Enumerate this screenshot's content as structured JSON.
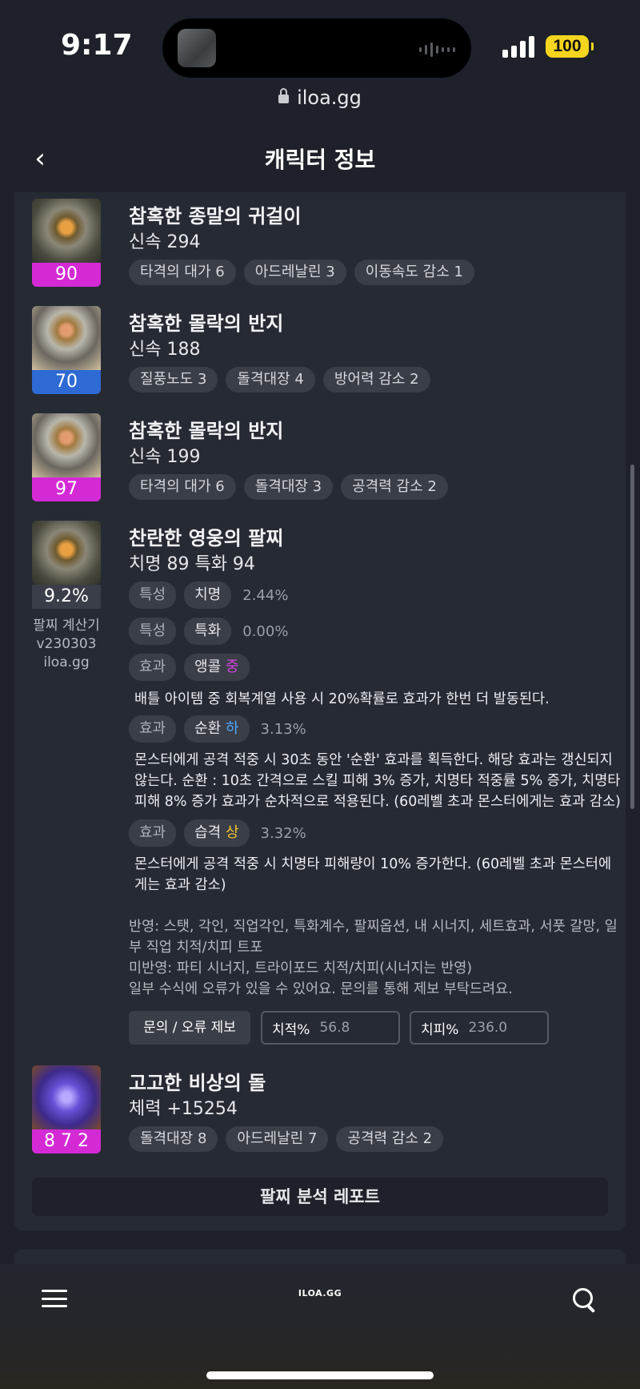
{
  "status": {
    "time": "9:17",
    "battery": "100"
  },
  "browser": {
    "url": "iloa.gg"
  },
  "header": {
    "title": "캐릭터 정보",
    "back_icon": "chevron-left-icon"
  },
  "accessories": [
    {
      "name": "참혹한 종말의 귀걸이",
      "stat": "신속 294",
      "quality": "90",
      "quality_color": "#d42ad6",
      "engravings": [
        "타격의 대가 6",
        "아드레날린 3",
        "이동속도 감소 1"
      ]
    },
    {
      "name": "참혹한 몰락의 반지",
      "stat": "신속 188",
      "quality": "70",
      "quality_color": "#2d6ad4",
      "engravings": [
        "질풍노도 3",
        "돌격대장 4",
        "방어력 감소 2"
      ]
    },
    {
      "name": "참혹한 몰락의 반지",
      "stat": "신속 199",
      "quality": "97",
      "quality_color": "#d42ad6",
      "engravings": [
        "타격의 대가 6",
        "돌격대장 3",
        "공격력 감소 2"
      ]
    }
  ],
  "bracelet": {
    "name": "찬란한 영웅의 팔찌",
    "stat": "치명 89  특화 94",
    "percent": "9.2%",
    "calc_label": "팔찌 계산기",
    "calc_version": "v230303",
    "calc_site": "iloa.gg",
    "traits": [
      {
        "tag": "특성",
        "name": "치명",
        "value": "2.44%"
      },
      {
        "tag": "특성",
        "name": "특화",
        "value": "0.00%"
      }
    ],
    "effects": [
      {
        "tag": "효과",
        "name": "앵콜",
        "grade": "중",
        "value": "",
        "desc": "배틀 아이템 중 회복계열 사용 시 20%확률로 효과가 한번 더 발동된다."
      },
      {
        "tag": "효과",
        "name": "순환",
        "grade": "하",
        "value": "3.13%",
        "desc": "몬스터에게 공격 적중 시 30초 동안 '순환' 효과를 획득한다. 해당 효과는 갱신되지 않는다. 순환 : 10초 간격으로 스킬 피해 3% 증가, 치명타 적중률 5% 증가, 치명타 피해 8% 증가 효과가 순차적으로 적용된다. (60레벨 초과 몬스터에게는 효과 감소)"
      },
      {
        "tag": "효과",
        "name": "습격",
        "grade": "상",
        "value": "3.32%",
        "desc": "몬스터에게 공격 적중 시 치명타 피해량이 10% 증가한다. (60레벨 초과 몬스터에게는 효과 감소)"
      }
    ],
    "notes": {
      "applied": "반영: 스탯, 각인, 직업각인, 특화계수, 팔찌옵션, 내 시너지, 세트효과, 서풋 갈망, 일부 직업 치적/치피 트포",
      "not_applied": "미반영: 파티 시너지, 트라이포드 치적/치피(시너지는 반영)",
      "disclaimer": "일부 수식에 오류가 있을 수 있어요. 문의를 통해 제보 부탁드려요."
    },
    "report_button": "문의 / 오류 제보",
    "crit_rate_label": "치적%",
    "crit_rate_value": "56.8",
    "crit_dmg_label": "치피%",
    "crit_dmg_value": "236.0"
  },
  "stone": {
    "name": "고고한 비상의 돌",
    "stat": "체력 +15254",
    "level": "8 7 2",
    "engravings": [
      "돌격대장 8",
      "아드레날린 7",
      "공격력 감소 2"
    ]
  },
  "analysis_button": "팔찌 분석 레포트",
  "bottom_bar": {
    "brand": "ILOA.GG",
    "menu_icon": "hamburger-menu-icon",
    "search_icon": "search-icon"
  }
}
